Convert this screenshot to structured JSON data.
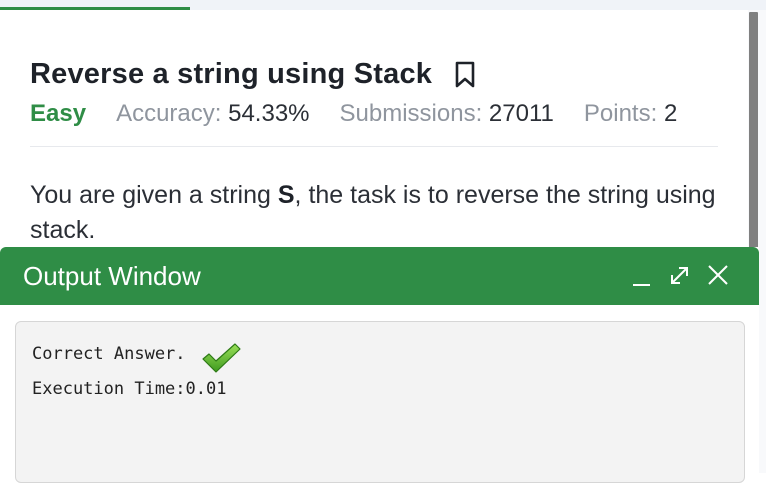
{
  "problem": {
    "title": "Reverse a string using Stack",
    "difficulty": "Easy",
    "accuracy_label": "Accuracy:",
    "accuracy_value": "54.33%",
    "submissions_label": "Submissions:",
    "submissions_value": "27011",
    "points_label": "Points:",
    "points_value": "2",
    "description_pre": "You are given a string ",
    "description_var": "S",
    "description_post": ", the task is to reverse the string using stack."
  },
  "output_window": {
    "title": "Output Window",
    "result": "Correct Answer.",
    "execution_time": "Execution Time:0.01"
  },
  "icons": [
    "bookmark-icon",
    "minimize-icon",
    "expand-icon",
    "close-icon",
    "checkmark-icon"
  ],
  "colors": {
    "accent_green": "#2f8d46",
    "title_text": "#1e2229",
    "muted_label": "#8f959e",
    "console_bg": "#f3f3f3"
  }
}
